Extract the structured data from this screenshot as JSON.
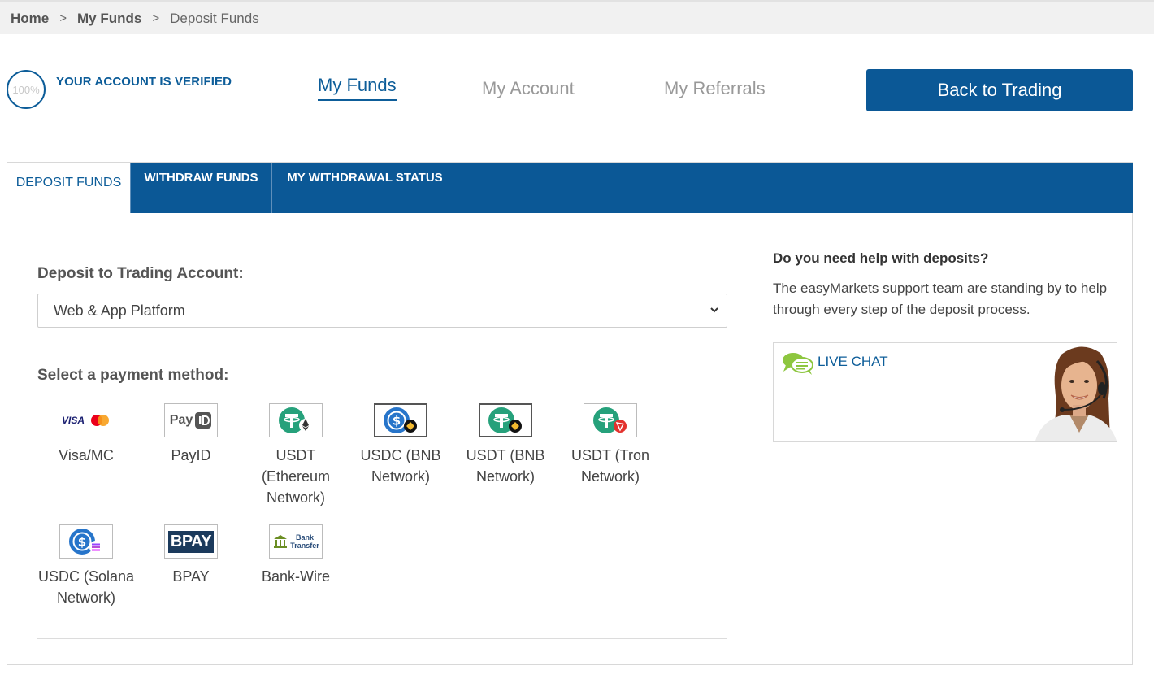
{
  "breadcrumb": {
    "home": "Home",
    "sep": ">",
    "my_funds": "My Funds",
    "current": "Deposit Funds"
  },
  "verification": {
    "percent": "100%",
    "text": "YOUR ACCOUNT IS VERIFIED"
  },
  "nav": {
    "items": [
      {
        "label": "My Funds",
        "active": true
      },
      {
        "label": "My Account",
        "active": false
      },
      {
        "label": "My Referrals",
        "active": false
      }
    ],
    "back_button": "Back to Trading"
  },
  "tabs": [
    {
      "label": "DEPOSIT FUNDS",
      "active": true
    },
    {
      "label": "WITHDRAW FUNDS",
      "active": false
    },
    {
      "label": "MY WITHDRAWAL STATUS",
      "active": false
    }
  ],
  "deposit": {
    "account_label": "Deposit to Trading Account:",
    "account_value": "Web & App Platform",
    "method_label": "Select a payment method:"
  },
  "methods": [
    {
      "name": "Visa/MC",
      "icon": "visa-mastercard-logo"
    },
    {
      "name": "PayID",
      "icon": "payid-logo"
    },
    {
      "name": "USDT (Ethereum Network)",
      "icon": "usdt-ethereum-logo"
    },
    {
      "name": "USDC (BNB Network)",
      "icon": "usdc-bnb-logo"
    },
    {
      "name": "USDT (BNB Network)",
      "icon": "usdt-bnb-logo"
    },
    {
      "name": "USDT (Tron Network)",
      "icon": "usdt-tron-logo"
    },
    {
      "name": "USDC (Solana Network)",
      "icon": "usdc-solana-logo"
    },
    {
      "name": "BPAY",
      "icon": "bpay-logo"
    },
    {
      "name": "Bank-Wire",
      "icon": "bank-transfer-logo"
    }
  ],
  "logo_text": {
    "visa": "VISA",
    "payid": "Pay",
    "bpay": "BPAY",
    "bank_line1": "Bank",
    "bank_line2": "Transfer"
  },
  "help": {
    "title": "Do you need help with deposits?",
    "text": "The easyMarkets support team are standing by to help through every step of the deposit process.",
    "chat_label": "LIVE CHAT"
  },
  "colors": {
    "brand_blue": "#0b5896",
    "usdt_green": "#26a17b",
    "usdc_blue": "#2775ca",
    "bnb_gold": "#f3ba2f",
    "tron_red": "#e3312d",
    "chat_green": "#8dc63f"
  }
}
